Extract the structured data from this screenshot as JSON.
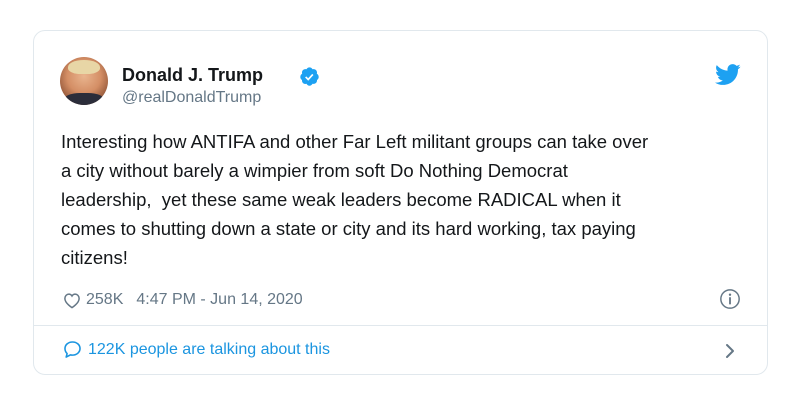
{
  "tweet": {
    "author_name": "Donald J. Trump",
    "handle": "@realDonaldTrump",
    "text": "Interesting how ANTIFA and other Far Left militant groups can take over\na city without barely a wimpier from soft Do Nothing Democrat\nleadership,  yet these same weak leaders become RADICAL when it\ncomes to shutting down a state or city and its hard working, tax paying\ncitizens!",
    "likes": "258K",
    "timestamp": "4:47 PM - Jun 14, 2020",
    "talking_label": "122K people are talking about this"
  },
  "icons": {
    "avatar": "profile-photo",
    "verified": "verified-badge-icon",
    "brand": "twitter-bird-icon",
    "like": "heart-icon",
    "info": "info-icon",
    "reply": "speech-bubble-icon",
    "chevron": "chevron-right-icon"
  },
  "colors": {
    "accent": "#1da1f2",
    "link": "#1b95e0",
    "text": "#14171a",
    "muted": "#657786",
    "border": "#e1e8ed"
  }
}
